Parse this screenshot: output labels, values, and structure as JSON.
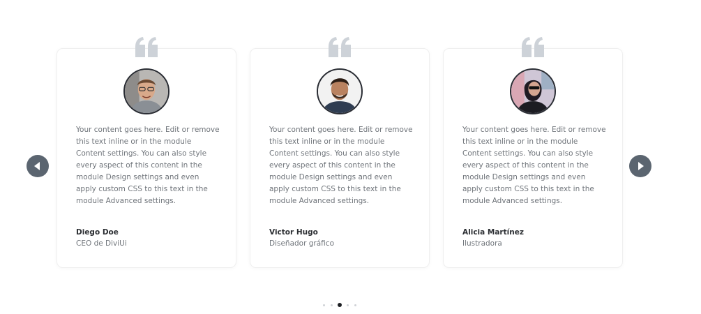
{
  "slider": {
    "prev_icon": "triangle-left-icon",
    "next_icon": "triangle-right-icon",
    "arrow_color": "#5b6570",
    "dot_count": 5,
    "active_dot": 3
  },
  "testimonials": [
    {
      "quote_icon": "quote-icon",
      "avatar": "avatar-photo",
      "text": "Your content goes here. Edit or remove this text inline or in the module Content settings. You can also style every aspect of this content in the module Design settings and even apply custom CSS to this text in the module Advanced settings.",
      "name": "Diego Doe",
      "role": "CEO de DiviUi"
    },
    {
      "quote_icon": "quote-icon",
      "avatar": "avatar-photo",
      "text": "Your content goes here. Edit or remove this text inline or in the module Content settings. You can also style every aspect of this content in the module Design settings and even apply custom CSS to this text in the module Advanced settings.",
      "name": "Victor Hugo",
      "role": "Diseñador gráfico"
    },
    {
      "quote_icon": "quote-icon",
      "avatar": "avatar-photo",
      "text": "Your content goes here. Edit or remove this text inline or in the module Content settings. You can also style every aspect of this content in the module Design settings and even apply custom CSS to this text in the module Advanced settings.",
      "name": "Alicia Martínez",
      "role": "Ilustradora"
    }
  ],
  "colors": {
    "quote": "#cdd2d8",
    "name": "#2c2f33",
    "text": "#6f747a",
    "active_dot": "#1e2024"
  }
}
